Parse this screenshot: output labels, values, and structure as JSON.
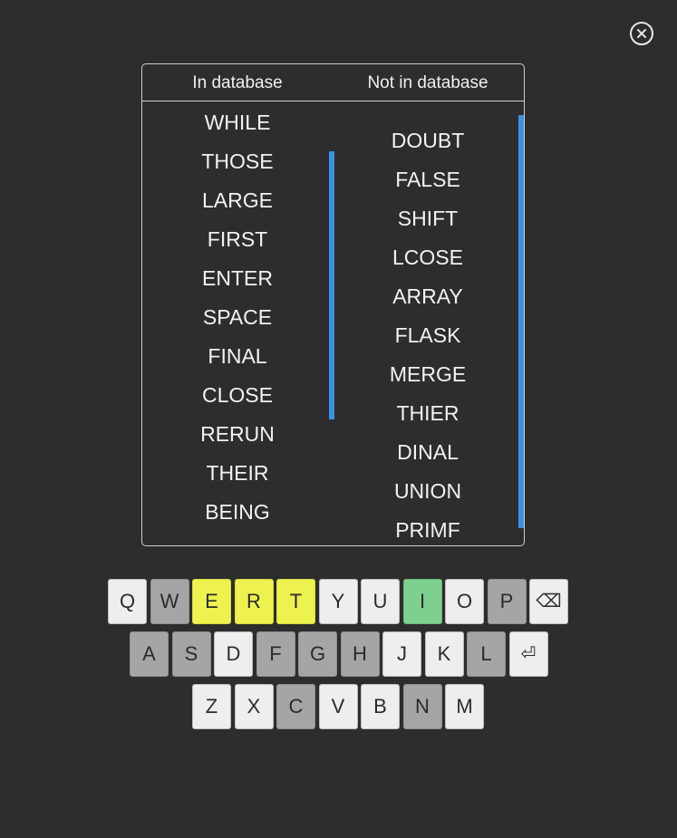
{
  "columns": {
    "in_db_label": "In database",
    "not_in_db_label": "Not in database"
  },
  "in_database": [
    "WHILE",
    "THOSE",
    "LARGE",
    "FIRST",
    "ENTER",
    "SPACE",
    "FINAL",
    "CLOSE",
    "RERUN",
    "THEIR",
    "BEING"
  ],
  "not_in_database": [
    "DOUBT",
    "FALSE",
    "SHIFT",
    "LCOSE",
    "ARRAY",
    "FLASK",
    "MERGE",
    "THIER",
    "DINAL",
    "UNION",
    "PRIMF"
  ],
  "keyboard": {
    "row1": [
      {
        "label": "Q",
        "state": "default"
      },
      {
        "label": "W",
        "state": "absent"
      },
      {
        "label": "E",
        "state": "present"
      },
      {
        "label": "R",
        "state": "present"
      },
      {
        "label": "T",
        "state": "present"
      },
      {
        "label": "Y",
        "state": "default"
      },
      {
        "label": "U",
        "state": "default"
      },
      {
        "label": "I",
        "state": "correct"
      },
      {
        "label": "O",
        "state": "default"
      },
      {
        "label": "P",
        "state": "absent"
      },
      {
        "label": "⌫",
        "state": "default",
        "name": "backspace-key"
      }
    ],
    "row2": [
      {
        "label": "A",
        "state": "absent"
      },
      {
        "label": "S",
        "state": "absent"
      },
      {
        "label": "D",
        "state": "default"
      },
      {
        "label": "F",
        "state": "absent"
      },
      {
        "label": "G",
        "state": "absent"
      },
      {
        "label": "H",
        "state": "absent"
      },
      {
        "label": "J",
        "state": "default"
      },
      {
        "label": "K",
        "state": "default"
      },
      {
        "label": "L",
        "state": "absent"
      },
      {
        "label": "⏎",
        "state": "default",
        "name": "enter-key"
      }
    ],
    "row3": [
      {
        "label": "Z",
        "state": "default"
      },
      {
        "label": "X",
        "state": "default"
      },
      {
        "label": "C",
        "state": "absent"
      },
      {
        "label": "V",
        "state": "default"
      },
      {
        "label": "B",
        "state": "default"
      },
      {
        "label": "N",
        "state": "absent"
      },
      {
        "label": "M",
        "state": "default"
      }
    ]
  },
  "colors": {
    "background": "#2d2d2d",
    "scrollbar": "#3a92e3",
    "key_default": "#eeeeee",
    "key_absent": "#a5a5a5",
    "key_present": "#eef24f",
    "key_correct": "#7fd08e"
  }
}
